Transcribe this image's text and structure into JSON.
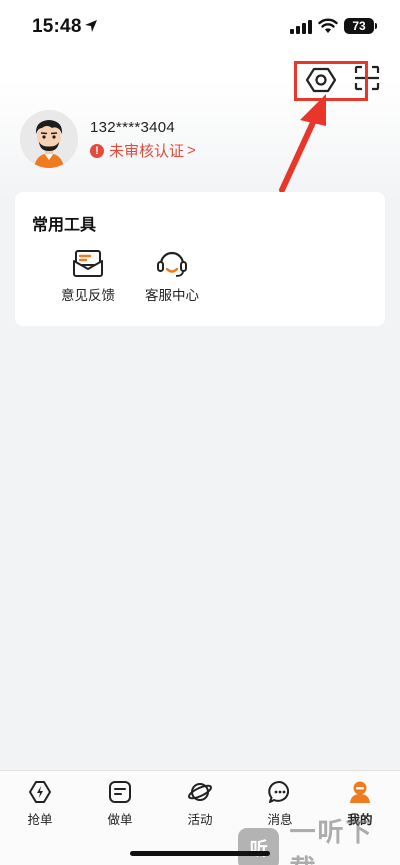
{
  "status_bar": {
    "time": "15:48",
    "battery": "73"
  },
  "profile": {
    "phone": "132****3404",
    "verify_text": "未审核认证",
    "chevron": ">"
  },
  "tools": {
    "title": "常用工具",
    "items": [
      {
        "label": "意见反馈",
        "icon": "feedback-icon"
      },
      {
        "label": "客服中心",
        "icon": "headset-icon"
      }
    ]
  },
  "tabbar": {
    "items": [
      {
        "label": "抢单",
        "icon": "lightning-icon"
      },
      {
        "label": "做单",
        "icon": "note-icon"
      },
      {
        "label": "活动",
        "icon": "planet-icon"
      },
      {
        "label": "消息",
        "icon": "chat-icon"
      },
      {
        "label": "我的",
        "icon": "person-icon",
        "active": true
      }
    ]
  },
  "watermark": {
    "logo": "听",
    "text": "一听下载"
  },
  "colors": {
    "accent": "#f07a1e",
    "alert": "#e34b3d",
    "annotation": "#e8372a"
  }
}
